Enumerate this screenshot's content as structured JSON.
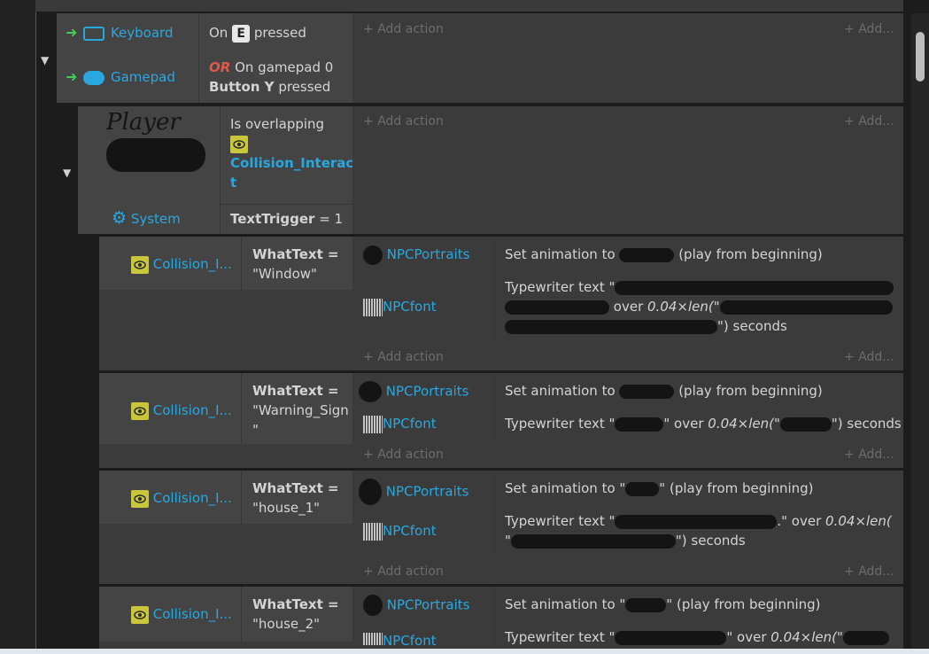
{
  "header": {
    "add_action_label": "Add action",
    "add_short_label": "Add..."
  },
  "event1": {
    "keyboard_label": "Keyboard",
    "gamepad_label": "Gamepad",
    "cond1": {
      "on": "On",
      "key": "E",
      "pressed": "pressed"
    },
    "cond2": {
      "or": "OR",
      "line1": "On gamepad 0",
      "button": "Button Y",
      "pressed": "pressed"
    }
  },
  "event2": {
    "handwritten_label": "Player",
    "system_label": "System",
    "cond1": {
      "text": "Is overlapping",
      "object_line1": "Collision_Interac",
      "object_line2": "t"
    },
    "cond2": {
      "var": "TextTrigger",
      "op": "= 1"
    }
  },
  "subevents": [
    {
      "object": "Collision_I...",
      "var": "WhatText =",
      "value_line1": "\"Window\"",
      "value_line2": "",
      "portraits": "NPCPortraits",
      "font": "NPCfont",
      "anim_prefix": "Set animation to",
      "anim_suffix": "(play from beginning)",
      "typewriter_prefix": "Typewriter text \"",
      "over": "over",
      "expr": "0.04×len(\"",
      "seconds": "\") seconds"
    },
    {
      "object": "Collision_I...",
      "var": "WhatText =",
      "value_line1": "\"Warning_Sign",
      "value_line2": "\"",
      "portraits": "NPCPortraits",
      "font": "NPCfont",
      "anim_prefix": "Set animation to",
      "anim_suffix": "(play from beginning)",
      "typewriter_prefix": "Typewriter text \"",
      "quote_over": "\" over",
      "expr": "0.04×len(\"",
      "seconds": "\") seconds"
    },
    {
      "object": "Collision_I...",
      "var": "WhatText =",
      "value_line1": "\"house_1\"",
      "value_line2": "",
      "portraits": "NPCPortraits",
      "font": "NPCfont",
      "anim_prefix": "Set animation to \"",
      "anim_suffix": "\" (play from beginning)",
      "typewriter_prefix": "Typewriter text \"",
      "quote_over": ".\" over",
      "expr": "0.04×len(",
      "line2_prefix": "\"",
      "seconds": "\") seconds"
    },
    {
      "object": "Collision_I...",
      "var": "WhatText =",
      "value_line1": "\"house_2\"",
      "value_line2": "",
      "portraits": "NPCPortraits",
      "font": "NPCfont",
      "anim_prefix": "Set animation to \"",
      "anim_suffix": "\" (play from beginning)",
      "typewriter_prefix": "Typewriter text \"",
      "quote_over": "\" over",
      "expr": "0.04×len(\""
    }
  ]
}
